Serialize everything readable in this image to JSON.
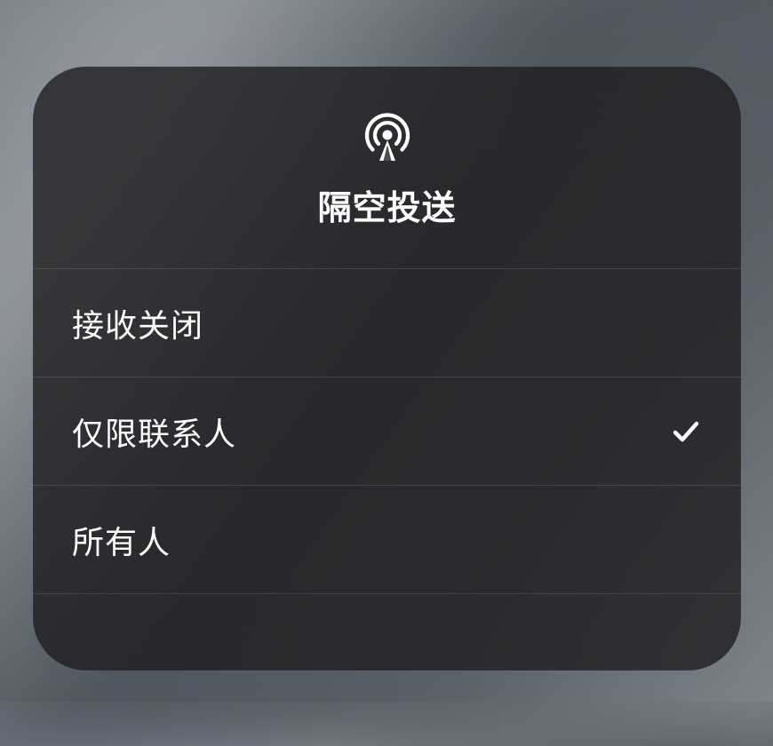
{
  "panel": {
    "title": "隔空投送",
    "iconName": "airdrop-icon"
  },
  "options": [
    {
      "label": "接收关闭",
      "selected": false
    },
    {
      "label": "仅限联系人",
      "selected": true
    },
    {
      "label": "所有人",
      "selected": false
    }
  ]
}
